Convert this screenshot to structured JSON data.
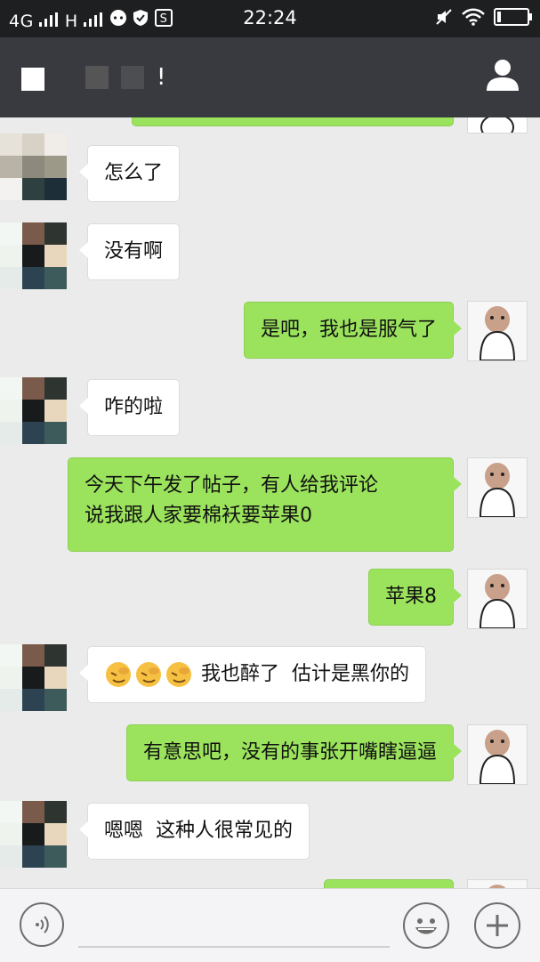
{
  "status_bar": {
    "network": "4G",
    "network2": "H",
    "time": "22:24"
  },
  "nav": {
    "title_suffix": "!"
  },
  "messages": [
    {
      "side": "left",
      "text": "怎么了"
    },
    {
      "side": "left",
      "text": "没有啊"
    },
    {
      "side": "right",
      "text": "是吧，我也是服气了"
    },
    {
      "side": "left",
      "text": "咋的啦"
    },
    {
      "side": "right",
      "line1": "今天下午发了帖子，有人给我评论",
      "line2": "说我跟人家要棉袄要苹果0"
    },
    {
      "side": "right",
      "text": "苹果8"
    },
    {
      "side": "left",
      "text": "我也醉了  估计是黑你的"
    },
    {
      "side": "right",
      "text": "有意思吧，没有的事张开嘴瞎逼逼"
    },
    {
      "side": "left",
      "text": "嗯嗯  这种人很常见的"
    }
  ],
  "icons": {
    "voice": "voice-icon",
    "emoji": "emoji-icon",
    "add": "plus-icon",
    "contact": "person-icon"
  },
  "colors": {
    "statusbar": "#1e1f21",
    "navbar": "#393a3f",
    "chat_bg": "#ebebeb",
    "bubble_right": "#9be35d",
    "bubble_left": "#ffffff"
  }
}
